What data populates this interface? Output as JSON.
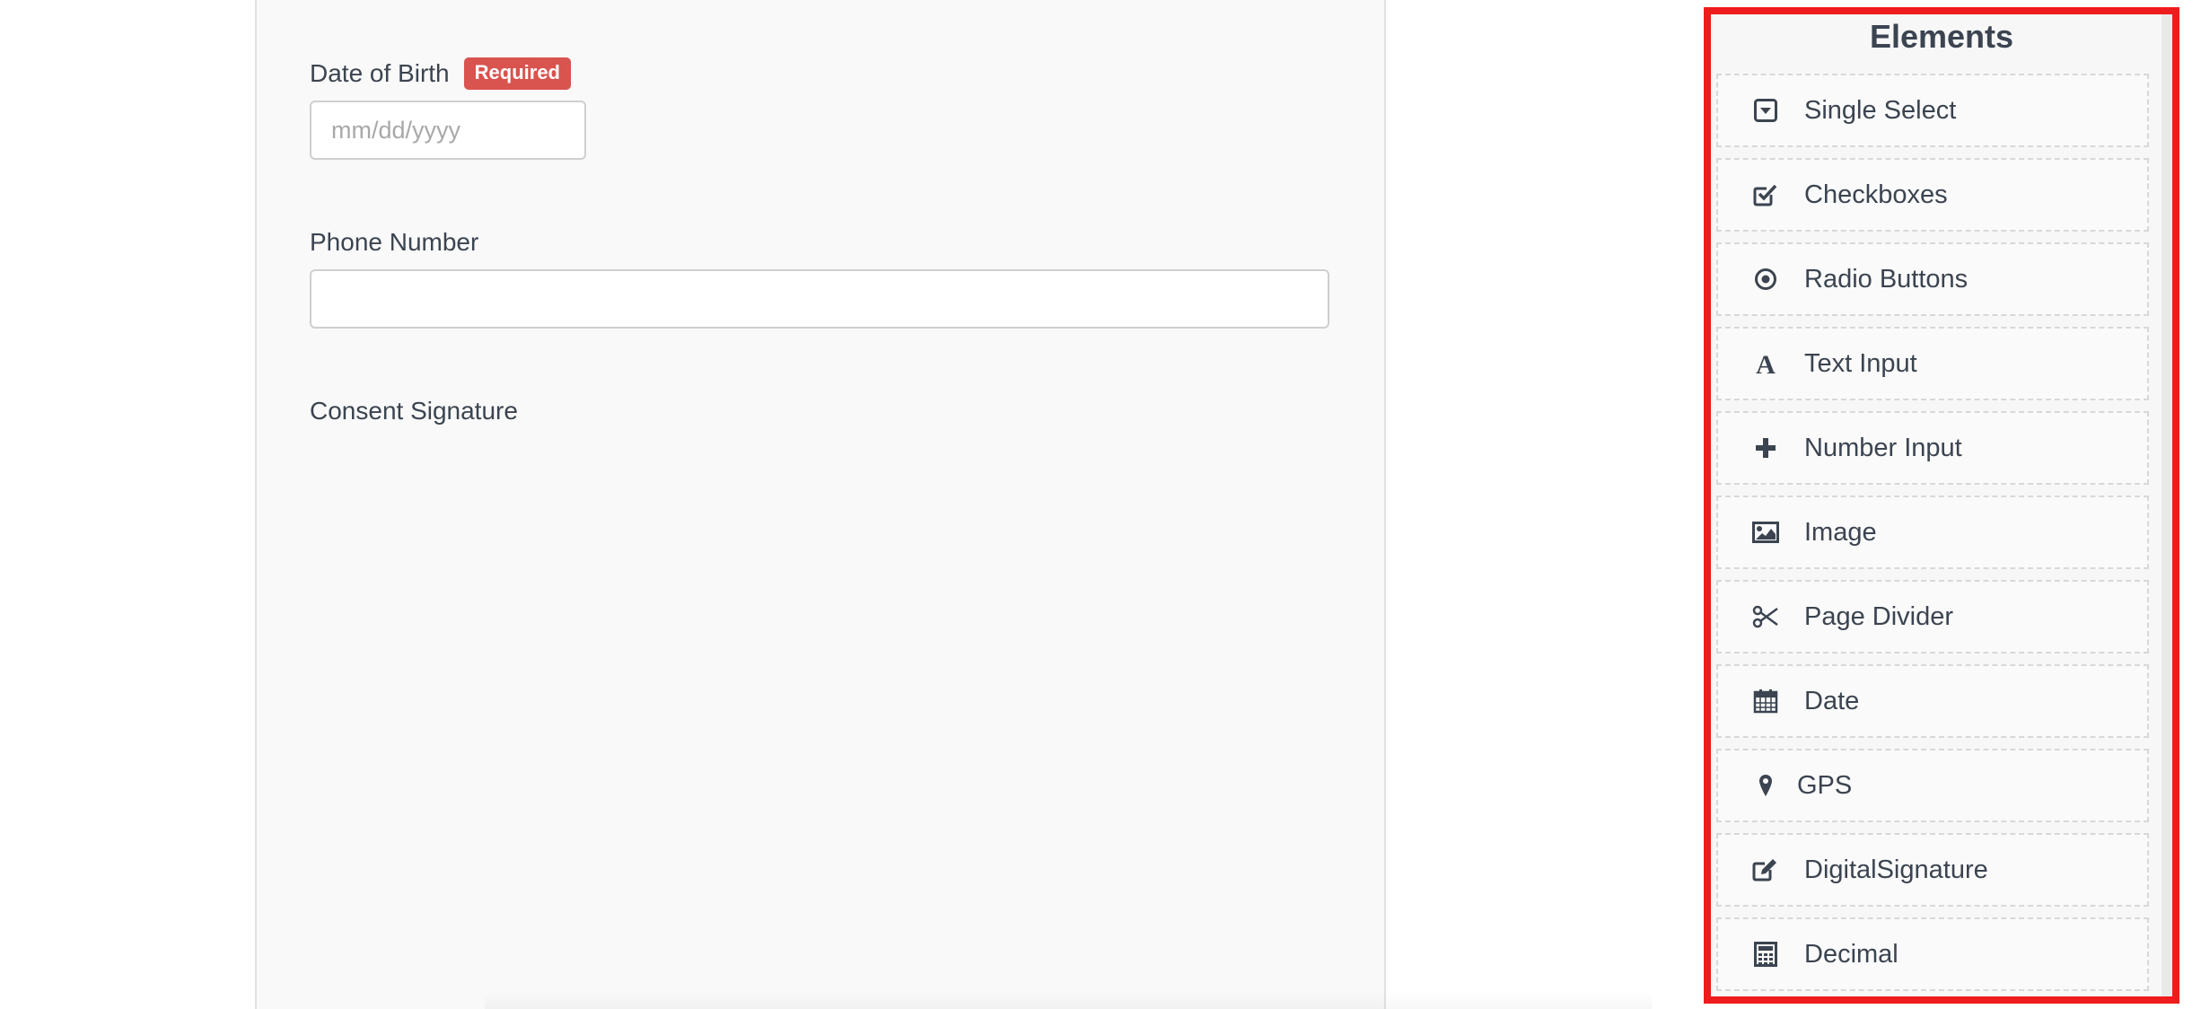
{
  "form": {
    "fields": [
      {
        "label": "Date of Birth",
        "badge": "Required",
        "placeholder": "mm/dd/yyyy"
      },
      {
        "label": "Phone Number",
        "placeholder": ""
      },
      {
        "label": "Consent Signature"
      }
    ]
  },
  "elements_panel": {
    "title": "Elements",
    "items": [
      {
        "label": "Single Select",
        "icon": "caret-square-down-icon"
      },
      {
        "label": "Checkboxes",
        "icon": "check-square-icon"
      },
      {
        "label": "Radio Buttons",
        "icon": "dot-circle-icon"
      },
      {
        "label": "Text Input",
        "icon": "font-icon"
      },
      {
        "label": "Number Input",
        "icon": "plus-icon"
      },
      {
        "label": "Image",
        "icon": "image-icon"
      },
      {
        "label": "Page Divider",
        "icon": "scissors-icon"
      },
      {
        "label": "Date",
        "icon": "calendar-icon"
      },
      {
        "label": "GPS",
        "icon": "map-marker-icon"
      },
      {
        "label": "DigitalSignature",
        "icon": "edit-icon"
      },
      {
        "label": "Decimal",
        "icon": "calculator-icon"
      }
    ]
  },
  "colors": {
    "highlight_border": "#ee1c1c",
    "required_badge": "#d9534f",
    "text": "#3b4450"
  }
}
